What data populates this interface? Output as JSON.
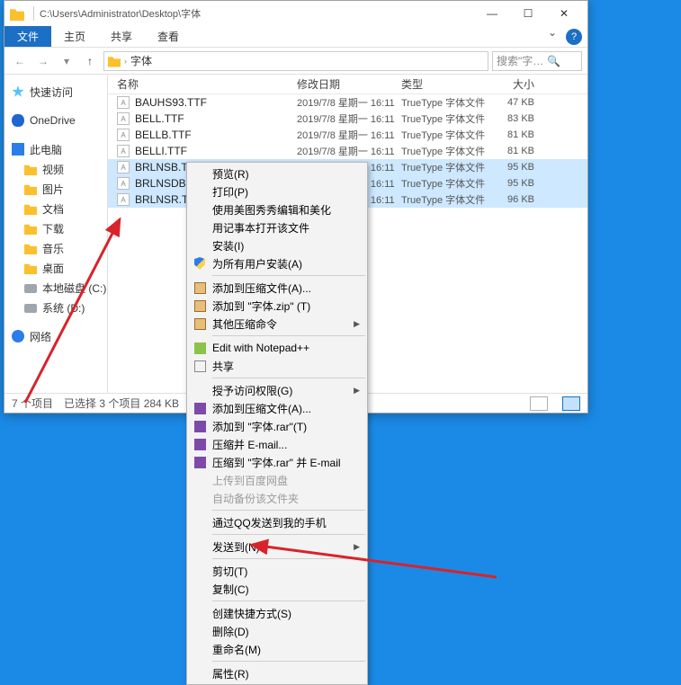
{
  "window": {
    "title_path": "C:\\Users\\Administrator\\Desktop\\字体",
    "min_glyph": "—",
    "max_glyph": "☐",
    "close_glyph": "✕"
  },
  "ribbon": {
    "file": "文件",
    "home": "主页",
    "share": "共享",
    "view": "查看",
    "help_glyph": "?",
    "expand_glyph": "⌄"
  },
  "nav": {
    "back": "←",
    "fwd": "→",
    "drop": "▾",
    "up": "↑",
    "crumb": "字体",
    "crumb_sep": "›",
    "search_placeholder": "搜索\"字…",
    "search_glyph": "🔍"
  },
  "sidebar": {
    "items": [
      {
        "icon": "star",
        "label": "快速访问",
        "indent": 0
      },
      {
        "icon": "cloud",
        "label": "OneDrive",
        "indent": 0
      },
      {
        "icon": "pc",
        "label": "此电脑",
        "indent": 0
      },
      {
        "icon": "fol",
        "label": "视频",
        "indent": 1
      },
      {
        "icon": "fol",
        "label": "图片",
        "indent": 1
      },
      {
        "icon": "fol",
        "label": "文档",
        "indent": 1
      },
      {
        "icon": "fol",
        "label": "下载",
        "indent": 1
      },
      {
        "icon": "fol",
        "label": "音乐",
        "indent": 1
      },
      {
        "icon": "fol",
        "label": "桌面",
        "indent": 1
      },
      {
        "icon": "drv",
        "label": "本地磁盘 (C:)",
        "indent": 1
      },
      {
        "icon": "drv",
        "label": "系统 (D:)",
        "indent": 1
      },
      {
        "icon": "net",
        "label": "网络",
        "indent": 0
      }
    ]
  },
  "columns": {
    "name": "名称",
    "date": "修改日期",
    "type": "类型",
    "size": "大小"
  },
  "files": [
    {
      "name": "BAUHS93.TTF",
      "date": "2019/7/8 星期一 16:11",
      "type": "TrueType 字体文件",
      "size": "47 KB",
      "sel": false
    },
    {
      "name": "BELL.TTF",
      "date": "2019/7/8 星期一 16:11",
      "type": "TrueType 字体文件",
      "size": "83 KB",
      "sel": false
    },
    {
      "name": "BELLB.TTF",
      "date": "2019/7/8 星期一 16:11",
      "type": "TrueType 字体文件",
      "size": "81 KB",
      "sel": false
    },
    {
      "name": "BELLI.TTF",
      "date": "2019/7/8 星期一 16:11",
      "type": "TrueType 字体文件",
      "size": "81 KB",
      "sel": false
    },
    {
      "name": "BRLNSB.TTF",
      "date": "2019/7/8 星期一 16:11",
      "type": "TrueType 字体文件",
      "size": "95 KB",
      "sel": true
    },
    {
      "name": "BRLNSDB.TTF",
      "date": "2019/7/8 星期一 16:11",
      "type": "TrueType 字体文件",
      "size": "95 KB",
      "sel": true
    },
    {
      "name": "BRLNSR.TTF",
      "date": "2019/7/8 星期一 16:11",
      "type": "TrueType 字体文件",
      "size": "96 KB",
      "sel": true
    }
  ],
  "status": {
    "count": "7 个项目",
    "sel": "已选择 3 个项目  284 KB"
  },
  "context_menu": [
    {
      "t": "item",
      "label": "预览(R)"
    },
    {
      "t": "item",
      "label": "打印(P)"
    },
    {
      "t": "item",
      "label": "使用美图秀秀编辑和美化"
    },
    {
      "t": "item",
      "label": "用记事本打开该文件"
    },
    {
      "t": "item",
      "label": "安装(I)"
    },
    {
      "t": "item",
      "label": "为所有用户安装(A)",
      "icon": "shield"
    },
    {
      "t": "sep"
    },
    {
      "t": "item",
      "label": "添加到压缩文件(A)...",
      "icon": "box"
    },
    {
      "t": "item",
      "label": "添加到 \"字体.zip\" (T)",
      "icon": "box"
    },
    {
      "t": "item",
      "label": "其他压缩命令",
      "icon": "box",
      "sub": true
    },
    {
      "t": "sep"
    },
    {
      "t": "item",
      "label": "Edit with Notepad++",
      "icon": "np"
    },
    {
      "t": "item",
      "label": "共享",
      "icon": "share"
    },
    {
      "t": "sep"
    },
    {
      "t": "item",
      "label": "授予访问权限(G)",
      "sub": true
    },
    {
      "t": "item",
      "label": "添加到压缩文件(A)...",
      "icon": "rar"
    },
    {
      "t": "item",
      "label": "添加到 \"字体.rar\"(T)",
      "icon": "rar"
    },
    {
      "t": "item",
      "label": "压缩并 E-mail...",
      "icon": "rar"
    },
    {
      "t": "item",
      "label": "压缩到 \"字体.rar\" 并 E-mail",
      "icon": "rar"
    },
    {
      "t": "item",
      "label": "上传到百度网盘",
      "dis": true
    },
    {
      "t": "item",
      "label": "自动备份该文件夹",
      "dis": true
    },
    {
      "t": "sep"
    },
    {
      "t": "item",
      "label": "通过QQ发送到我的手机"
    },
    {
      "t": "sep"
    },
    {
      "t": "item",
      "label": "发送到(N)",
      "sub": true
    },
    {
      "t": "sep"
    },
    {
      "t": "item",
      "label": "剪切(T)"
    },
    {
      "t": "item",
      "label": "复制(C)"
    },
    {
      "t": "sep"
    },
    {
      "t": "item",
      "label": "创建快捷方式(S)"
    },
    {
      "t": "item",
      "label": "删除(D)"
    },
    {
      "t": "item",
      "label": "重命名(M)"
    },
    {
      "t": "sep"
    },
    {
      "t": "item",
      "label": "属性(R)"
    }
  ],
  "ttf_glyph": "A",
  "submenu_glyph": "▶"
}
